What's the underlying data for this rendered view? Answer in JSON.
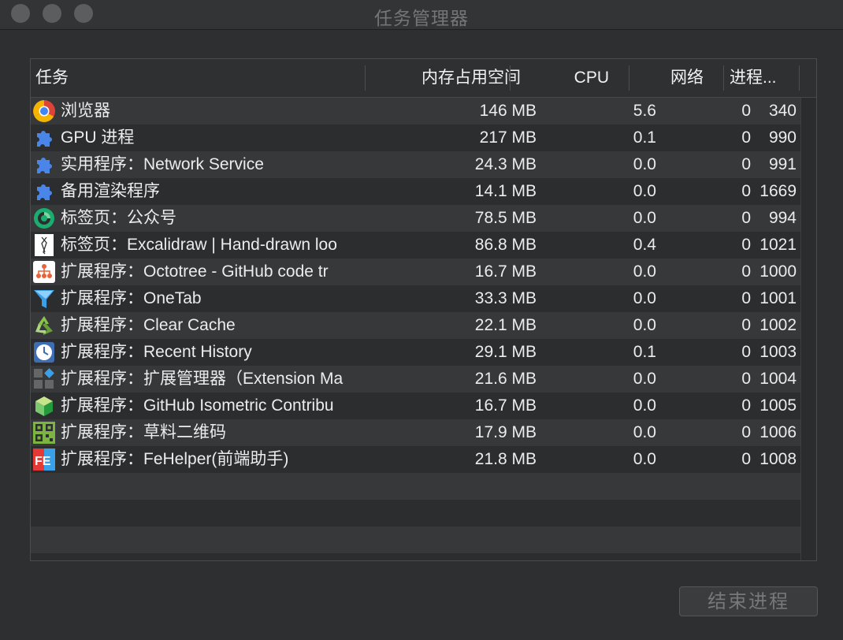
{
  "window": {
    "title": "任务管理器"
  },
  "table": {
    "columns": {
      "task": "任务",
      "memory": "内存占用空间",
      "cpu": "CPU",
      "network": "网络",
      "pid": "进程..."
    },
    "rows": [
      {
        "icon": "chrome-icon",
        "task": "浏览器",
        "memory": "146 MB",
        "cpu": "5.6",
        "network": "0",
        "pid": "340"
      },
      {
        "icon": "puzzle-icon",
        "task": "GPU 进程",
        "memory": "217 MB",
        "cpu": "0.1",
        "network": "0",
        "pid": "990"
      },
      {
        "icon": "puzzle-icon",
        "task": "实用程序：Network Service",
        "memory": "24.3 MB",
        "cpu": "0.0",
        "network": "0",
        "pid": "991"
      },
      {
        "icon": "puzzle-icon",
        "task": "备用渲染程序",
        "memory": "14.1 MB",
        "cpu": "0.0",
        "network": "0",
        "pid": "1669"
      },
      {
        "icon": "wechat-green-icon",
        "task": "标签页：公众号",
        "memory": "78.5 MB",
        "cpu": "0.0",
        "network": "0",
        "pid": "994"
      },
      {
        "icon": "excalidraw-icon",
        "task": "标签页：Excalidraw | Hand-drawn loo",
        "memory": "86.8 MB",
        "cpu": "0.4",
        "network": "0",
        "pid": "1021"
      },
      {
        "icon": "octotree-icon",
        "task": "扩展程序：Octotree - GitHub code tr",
        "memory": "16.7 MB",
        "cpu": "0.0",
        "network": "0",
        "pid": "1000"
      },
      {
        "icon": "funnel-icon",
        "task": "扩展程序：OneTab",
        "memory": "33.3 MB",
        "cpu": "0.0",
        "network": "0",
        "pid": "1001"
      },
      {
        "icon": "recycle-icon",
        "task": "扩展程序：Clear Cache",
        "memory": "22.1 MB",
        "cpu": "0.0",
        "network": "0",
        "pid": "1002"
      },
      {
        "icon": "history-icon",
        "task": "扩展程序：Recent History",
        "memory": "29.1 MB",
        "cpu": "0.1",
        "network": "0",
        "pid": "1003"
      },
      {
        "icon": "extension-manager-icon",
        "task": "扩展程序：扩展管理器（Extension Ma",
        "memory": "21.6 MB",
        "cpu": "0.0",
        "network": "0",
        "pid": "1004"
      },
      {
        "icon": "isometric-icon",
        "task": "扩展程序：GitHub Isometric Contribu",
        "memory": "16.7 MB",
        "cpu": "0.0",
        "network": "0",
        "pid": "1005"
      },
      {
        "icon": "qrcode-icon",
        "task": "扩展程序：草料二维码",
        "memory": "17.9 MB",
        "cpu": "0.0",
        "network": "0",
        "pid": "1006"
      },
      {
        "icon": "fehelper-icon",
        "task": "扩展程序：FeHelper(前端助手)",
        "memory": "21.8 MB",
        "cpu": "0.0",
        "network": "0",
        "pid": "1008"
      }
    ]
  },
  "footer": {
    "end_process_label": "结束进程"
  }
}
